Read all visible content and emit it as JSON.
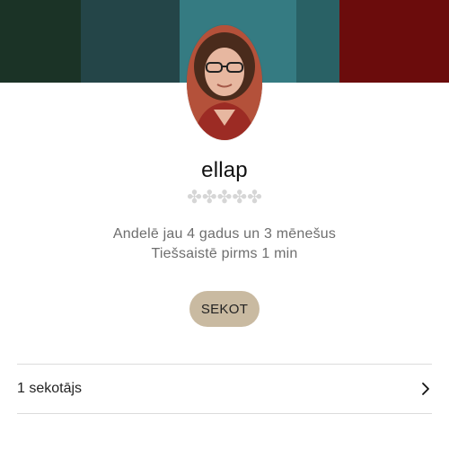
{
  "profile": {
    "username": "ellap",
    "rating_stars": "✤✤✤✤✤",
    "member_since": "Andelē jau 4 gadus un 3 mēnešus",
    "last_online": "Tiešsaistē pirms 1 min"
  },
  "actions": {
    "follow_label": "SEKOT"
  },
  "followers": {
    "label": "1 sekotājs"
  },
  "colors": {
    "follow_button": "#c9baa1",
    "secondary_text": "#6e6e6e",
    "divider": "#dcdcdc"
  },
  "icons": {
    "row_arrow": "chevron-right-icon"
  }
}
